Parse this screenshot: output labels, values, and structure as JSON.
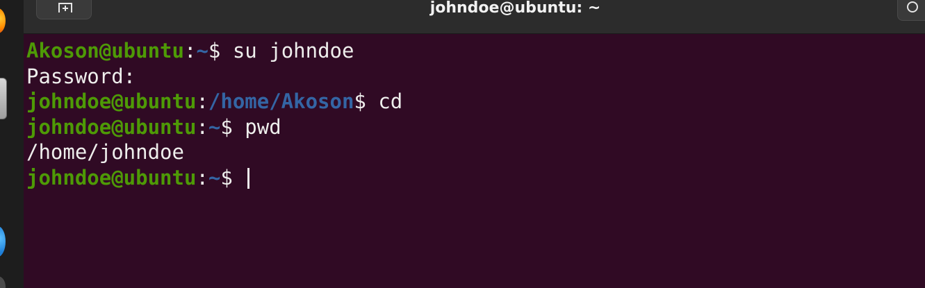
{
  "window": {
    "title": "johndoe@ubuntu: ~"
  },
  "colors": {
    "terminal_bg": "#300a24",
    "user_host": "#4e9a06",
    "path": "#3465a4",
    "text": "#eeeeec"
  },
  "terminal": {
    "lines": [
      {
        "user": "Akoson@ubuntu",
        "sep": ":",
        "path": "~",
        "prompt": "$",
        "text": " su johndoe"
      },
      {
        "text": "Password:"
      },
      {
        "user": "johndoe@ubuntu",
        "sep": ":",
        "path": "/home/Akoson",
        "prompt": "$",
        "text": " cd"
      },
      {
        "user": "johndoe@ubuntu",
        "sep": ":",
        "path": "~",
        "prompt": "$",
        "text": " pwd"
      },
      {
        "text": "/home/johndoe"
      },
      {
        "user": "johndoe@ubuntu",
        "sep": ":",
        "path": "~",
        "prompt": "$",
        "text": " "
      }
    ]
  },
  "icons": {
    "new_tab": "new-tab-icon",
    "search": "search-icon"
  }
}
